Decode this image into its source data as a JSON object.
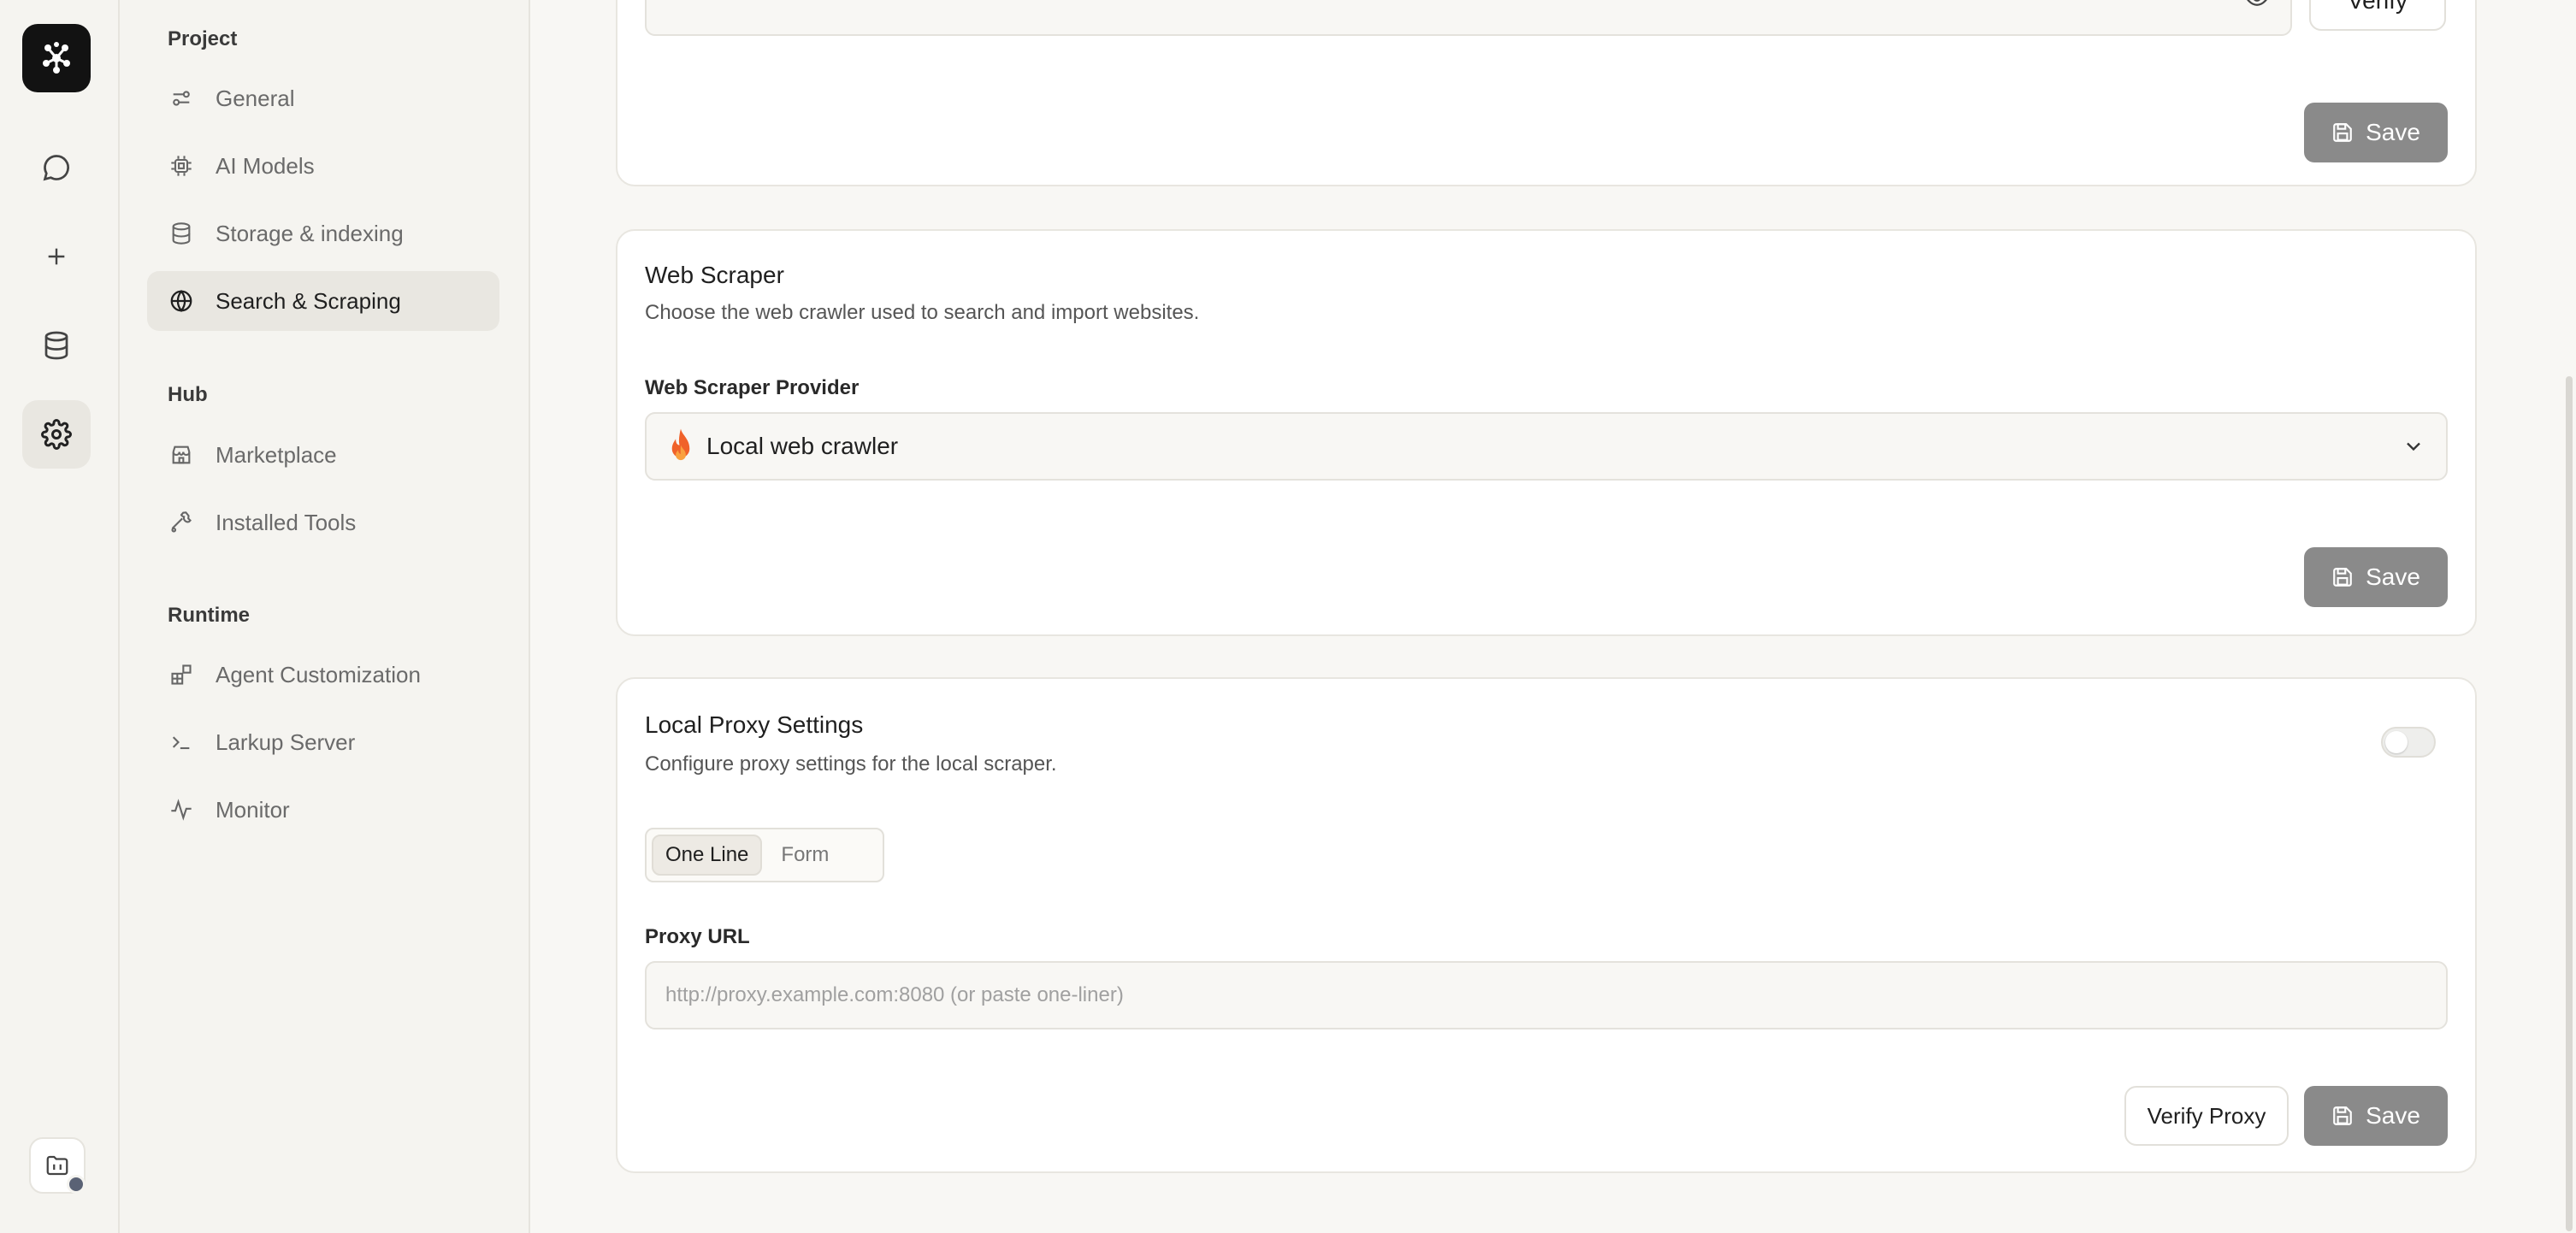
{
  "rail": {
    "items": [
      {
        "name": "chat",
        "icon": "chat-bubble-icon"
      },
      {
        "name": "new",
        "icon": "plus-icon"
      },
      {
        "name": "database",
        "icon": "database-icon"
      },
      {
        "name": "settings",
        "icon": "gear-icon",
        "active": true
      }
    ]
  },
  "sidebar": {
    "groups": [
      {
        "label": "Project",
        "items": [
          {
            "label": "General",
            "icon": "sliders-icon"
          },
          {
            "label": "AI Models",
            "icon": "cpu-icon"
          },
          {
            "label": "Storage & indexing",
            "icon": "database-icon"
          },
          {
            "label": "Search & Scraping",
            "icon": "globe-icon",
            "active": true
          }
        ]
      },
      {
        "label": "Hub",
        "items": [
          {
            "label": "Marketplace",
            "icon": "store-icon"
          },
          {
            "label": "Installed Tools",
            "icon": "wrench-icon"
          }
        ]
      },
      {
        "label": "Runtime",
        "items": [
          {
            "label": "Agent Customization",
            "icon": "blocks-icon"
          },
          {
            "label": "Larkup Server",
            "icon": "terminal-icon"
          },
          {
            "label": "Monitor",
            "icon": "activity-icon"
          }
        ]
      }
    ]
  },
  "api_key_card": {
    "masked_value": "•••••••••••••••••••••••••••••••••••••••••••••••••••••••",
    "verify_label": "Verify",
    "save_label": "Save"
  },
  "web_scraper": {
    "title": "Web Scraper",
    "description": "Choose the web crawler used to search and import websites.",
    "provider_label": "Web Scraper Provider",
    "provider_value": "Local web crawler",
    "save_label": "Save"
  },
  "proxy": {
    "title": "Local Proxy Settings",
    "description": "Configure proxy settings for the local scraper.",
    "enabled": false,
    "tabs": [
      "One Line",
      "Form"
    ],
    "active_tab": "One Line",
    "url_label": "Proxy URL",
    "url_placeholder": "http://proxy.example.com:8080 (or paste one-liner)",
    "verify_label": "Verify Proxy",
    "save_label": "Save"
  },
  "colors": {
    "accent_dark": "#121212",
    "save_button": "#8a8a8a",
    "flame": "#f0622a"
  }
}
